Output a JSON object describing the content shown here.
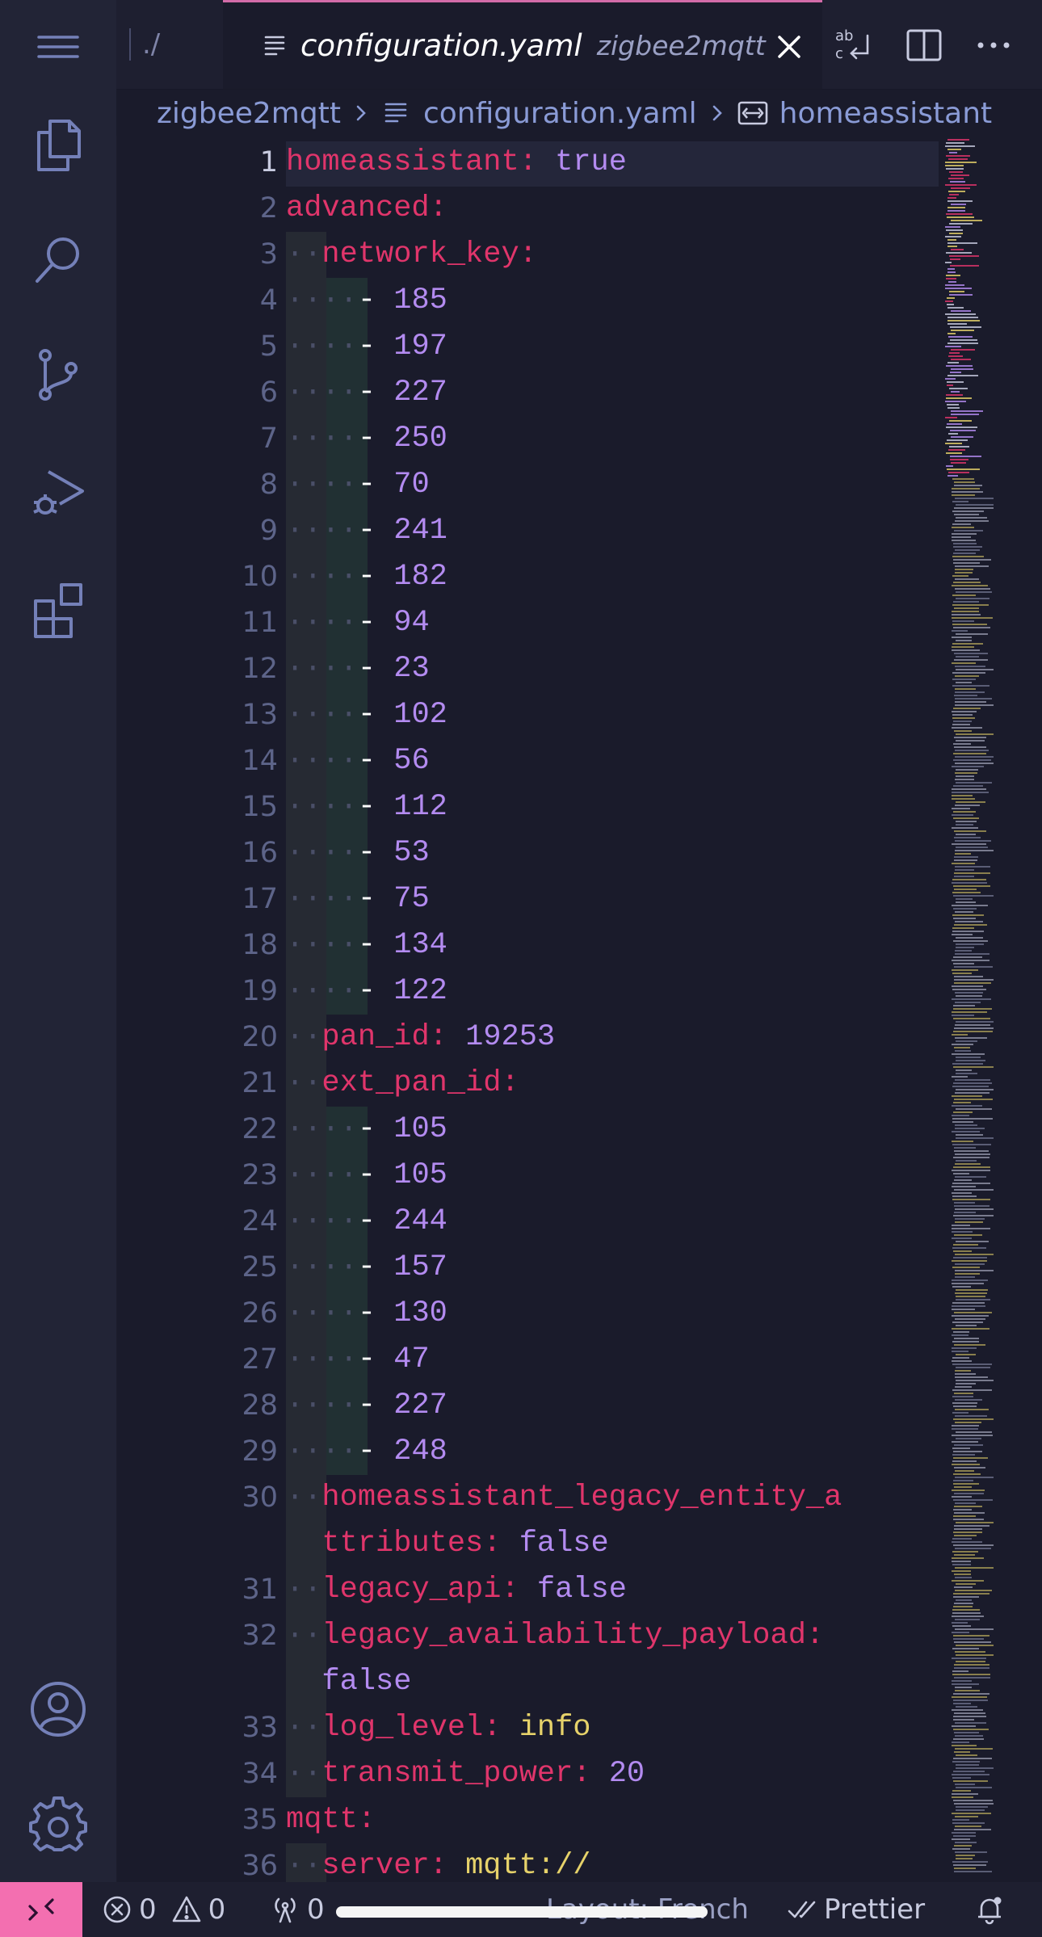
{
  "tabs": {
    "previous_label": "./",
    "active": {
      "title": "configuration.yaml",
      "description": "zigbee2mqtt"
    }
  },
  "breadcrumb": [
    "zigbee2mqtt",
    "configuration.yaml",
    "homeassistant"
  ],
  "editor": {
    "active_line": 1,
    "lines": [
      {
        "num": "1",
        "tokens": [
          [
            "k",
            "homeassistant"
          ],
          [
            "p",
            ": "
          ],
          [
            "b",
            "true"
          ]
        ]
      },
      {
        "num": "2",
        "tokens": [
          [
            "k",
            "advanced"
          ],
          [
            "p",
            ":"
          ]
        ]
      },
      {
        "num": "3",
        "tokens": [
          [
            "ws",
            "··"
          ],
          [
            "k",
            "network_key"
          ],
          [
            "p",
            ":"
          ]
        ]
      },
      {
        "num": "4",
        "tokens": [
          [
            "ws",
            "····"
          ],
          [
            "d",
            "- "
          ],
          [
            "n",
            "185"
          ]
        ]
      },
      {
        "num": "5",
        "tokens": [
          [
            "ws",
            "····"
          ],
          [
            "d",
            "- "
          ],
          [
            "n",
            "197"
          ]
        ]
      },
      {
        "num": "6",
        "tokens": [
          [
            "ws",
            "····"
          ],
          [
            "d",
            "- "
          ],
          [
            "n",
            "227"
          ]
        ]
      },
      {
        "num": "7",
        "tokens": [
          [
            "ws",
            "····"
          ],
          [
            "d",
            "- "
          ],
          [
            "n",
            "250"
          ]
        ]
      },
      {
        "num": "8",
        "tokens": [
          [
            "ws",
            "····"
          ],
          [
            "d",
            "- "
          ],
          [
            "n",
            "70"
          ]
        ]
      },
      {
        "num": "9",
        "tokens": [
          [
            "ws",
            "····"
          ],
          [
            "d",
            "- "
          ],
          [
            "n",
            "241"
          ]
        ]
      },
      {
        "num": "10",
        "tokens": [
          [
            "ws",
            "····"
          ],
          [
            "d",
            "- "
          ],
          [
            "n",
            "182"
          ]
        ]
      },
      {
        "num": "11",
        "tokens": [
          [
            "ws",
            "····"
          ],
          [
            "d",
            "- "
          ],
          [
            "n",
            "94"
          ]
        ]
      },
      {
        "num": "12",
        "tokens": [
          [
            "ws",
            "····"
          ],
          [
            "d",
            "- "
          ],
          [
            "n",
            "23"
          ]
        ]
      },
      {
        "num": "13",
        "tokens": [
          [
            "ws",
            "····"
          ],
          [
            "d",
            "- "
          ],
          [
            "n",
            "102"
          ]
        ]
      },
      {
        "num": "14",
        "tokens": [
          [
            "ws",
            "····"
          ],
          [
            "d",
            "- "
          ],
          [
            "n",
            "56"
          ]
        ]
      },
      {
        "num": "15",
        "tokens": [
          [
            "ws",
            "····"
          ],
          [
            "d",
            "- "
          ],
          [
            "n",
            "112"
          ]
        ]
      },
      {
        "num": "16",
        "tokens": [
          [
            "ws",
            "····"
          ],
          [
            "d",
            "- "
          ],
          [
            "n",
            "53"
          ]
        ]
      },
      {
        "num": "17",
        "tokens": [
          [
            "ws",
            "····"
          ],
          [
            "d",
            "- "
          ],
          [
            "n",
            "75"
          ]
        ]
      },
      {
        "num": "18",
        "tokens": [
          [
            "ws",
            "····"
          ],
          [
            "d",
            "- "
          ],
          [
            "n",
            "134"
          ]
        ]
      },
      {
        "num": "19",
        "tokens": [
          [
            "ws",
            "····"
          ],
          [
            "d",
            "- "
          ],
          [
            "n",
            "122"
          ]
        ]
      },
      {
        "num": "20",
        "tokens": [
          [
            "ws",
            "··"
          ],
          [
            "k",
            "pan_id"
          ],
          [
            "p",
            ": "
          ],
          [
            "n",
            "19253"
          ]
        ]
      },
      {
        "num": "21",
        "tokens": [
          [
            "ws",
            "··"
          ],
          [
            "k",
            "ext_pan_id"
          ],
          [
            "p",
            ":"
          ]
        ]
      },
      {
        "num": "22",
        "tokens": [
          [
            "ws",
            "····"
          ],
          [
            "d",
            "- "
          ],
          [
            "n",
            "105"
          ]
        ]
      },
      {
        "num": "23",
        "tokens": [
          [
            "ws",
            "····"
          ],
          [
            "d",
            "- "
          ],
          [
            "n",
            "105"
          ]
        ]
      },
      {
        "num": "24",
        "tokens": [
          [
            "ws",
            "····"
          ],
          [
            "d",
            "- "
          ],
          [
            "n",
            "244"
          ]
        ]
      },
      {
        "num": "25",
        "tokens": [
          [
            "ws",
            "····"
          ],
          [
            "d",
            "- "
          ],
          [
            "n",
            "157"
          ]
        ]
      },
      {
        "num": "26",
        "tokens": [
          [
            "ws",
            "····"
          ],
          [
            "d",
            "- "
          ],
          [
            "n",
            "130"
          ]
        ]
      },
      {
        "num": "27",
        "tokens": [
          [
            "ws",
            "····"
          ],
          [
            "d",
            "- "
          ],
          [
            "n",
            "47"
          ]
        ]
      },
      {
        "num": "28",
        "tokens": [
          [
            "ws",
            "····"
          ],
          [
            "d",
            "- "
          ],
          [
            "n",
            "227"
          ]
        ]
      },
      {
        "num": "29",
        "tokens": [
          [
            "ws",
            "····"
          ],
          [
            "d",
            "- "
          ],
          [
            "n",
            "248"
          ]
        ]
      },
      {
        "num": "30",
        "tokens": [
          [
            "ws",
            "··"
          ],
          [
            "k",
            "homeassistant_legacy_entity_a"
          ]
        ]
      },
      {
        "num": "",
        "tokens": [
          [
            "ws",
            "  "
          ],
          [
            "k",
            "ttributes"
          ],
          [
            "p",
            ": "
          ],
          [
            "b",
            "false"
          ]
        ]
      },
      {
        "num": "31",
        "tokens": [
          [
            "ws",
            "··"
          ],
          [
            "k",
            "legacy_api"
          ],
          [
            "p",
            ": "
          ],
          [
            "b",
            "false"
          ]
        ]
      },
      {
        "num": "32",
        "tokens": [
          [
            "ws",
            "··"
          ],
          [
            "k",
            "legacy_availability_payload"
          ],
          [
            "p",
            ":"
          ]
        ]
      },
      {
        "num": "",
        "tokens": [
          [
            "ws",
            "  "
          ],
          [
            "b",
            "false"
          ]
        ]
      },
      {
        "num": "33",
        "tokens": [
          [
            "ws",
            "··"
          ],
          [
            "k",
            "log_level"
          ],
          [
            "p",
            ": "
          ],
          [
            "s",
            "info"
          ]
        ]
      },
      {
        "num": "34",
        "tokens": [
          [
            "ws",
            "··"
          ],
          [
            "k",
            "transmit_power"
          ],
          [
            "p",
            ": "
          ],
          [
            "n",
            "20"
          ]
        ]
      },
      {
        "num": "35",
        "tokens": [
          [
            "k",
            "mqtt"
          ],
          [
            "p",
            ":"
          ]
        ]
      },
      {
        "num": "36",
        "tokens": [
          [
            "ws",
            "··"
          ],
          [
            "k",
            "server"
          ],
          [
            "p",
            ": "
          ],
          [
            "s",
            "mqtt://"
          ]
        ]
      }
    ]
  },
  "statusbar": {
    "errors": "0",
    "warnings": "0",
    "ports": "0",
    "layout": "Layout: French",
    "formatter": "Prettier"
  },
  "colors": {
    "accent": "#f36fb0",
    "keyword": "#e0356b",
    "number": "#b38bf0",
    "string": "#e6d26a",
    "background": "#1a1b2b"
  }
}
